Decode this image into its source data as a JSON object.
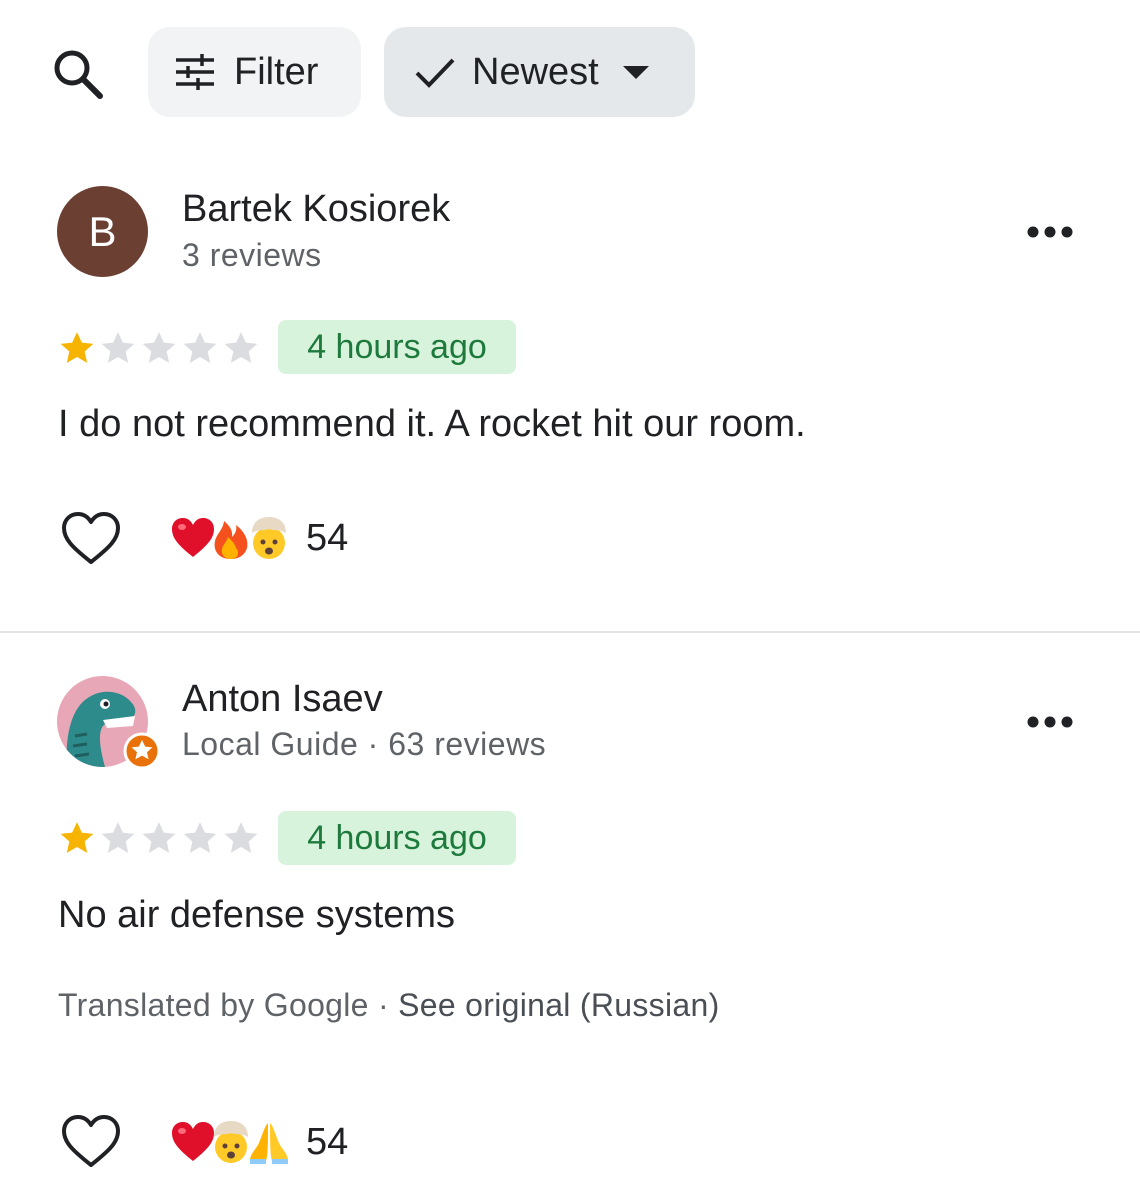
{
  "toolbar": {
    "search_icon": "search-icon",
    "filter_label": "Filter",
    "filter_icon": "tune-icon",
    "sort_label": "Newest",
    "sort_icons": [
      "check-icon",
      "caret-down-icon"
    ]
  },
  "reviews": [
    {
      "avatar_letter": "B",
      "avatar_color": "#6b3f32",
      "author": "Bartek Kosiorek",
      "meta": "3 reviews",
      "rating": 1,
      "max_rating": 5,
      "time": "4 hours ago",
      "text": "I do not recommend it. A rocket hit our room.",
      "reactions": [
        "heart-emoji",
        "fire-emoji",
        "exploding-head-emoji"
      ],
      "reaction_count": "54"
    },
    {
      "avatar_image": "dinosaur-avatar",
      "badge": "local-guide-star-icon",
      "author": "Anton Isaev",
      "meta": "Local Guide · 63 reviews",
      "rating": 1,
      "max_rating": 5,
      "time": "4 hours ago",
      "text": "No air defense systems",
      "translated_prefix": "Translated by Google · ",
      "see_original": "See original (Russian)",
      "reactions": [
        "heart-emoji",
        "exploding-head-emoji",
        "folded-hands-emoji"
      ],
      "reaction_count": "54"
    }
  ],
  "colors": {
    "star_filled": "#f6b400",
    "star_empty": "#dadce0",
    "time_badge_bg": "#d8f3dc",
    "time_badge_text": "#1e7a3c",
    "divider": "#e3e3e3"
  }
}
